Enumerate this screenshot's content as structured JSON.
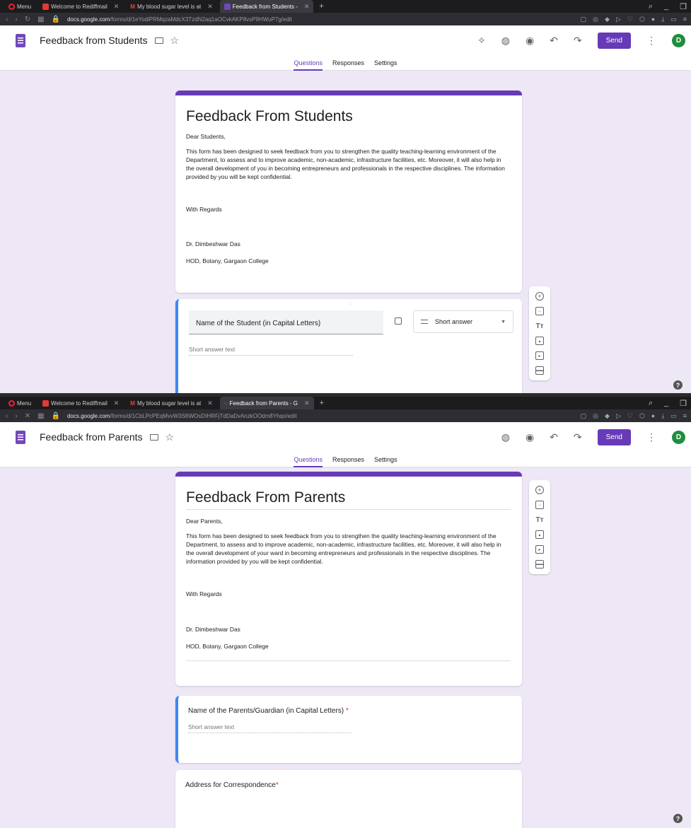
{
  "screen1": {
    "tabs": [
      {
        "label": "Menu"
      },
      {
        "label": "Welcome to Rediffmail"
      },
      {
        "label": "My blood sugar level is at"
      },
      {
        "label": "Feedback from Students - "
      }
    ],
    "url_host": "docs.google.com",
    "url_path": "/forms/d/1eYodiPRMqzaMdcX3TzdN2aq1aOCvkAKP8vsP9HWuP7g/edit",
    "doc_title": "Feedback from Students",
    "send_label": "Send",
    "avatar_letter": "D",
    "subtabs": [
      "Questions",
      "Responses",
      "Settings"
    ],
    "form_title": "Feedback From Students",
    "greeting": "Dear Students,",
    "body": "This form has been designed to seek feedback from you to strengthen the quality teaching-learning environment of the Department,  to assess and to improve academic, non-academic, infrastructure facilities, etc. Moreover, it will also help in the overall development of you in becoming entrepreneurs and professionals in the respective disciplines. The information provided by you will be kept confidential.",
    "regards": "With Regards",
    "signer": "Dr. Dimbeshwar Das",
    "designation": "HOD, Botany, Gargaon College",
    "question_title": "Name of the Student (in Capital Letters)",
    "question_type": "Short answer",
    "answer_placeholder": "Short answer text"
  },
  "screen2": {
    "tabs": [
      {
        "label": "Menu"
      },
      {
        "label": "Welcome to Rediffmail"
      },
      {
        "label": "My blood sugar level is at"
      },
      {
        "label": "Feedback from Parents - G"
      }
    ],
    "url_host": "docs.google.com",
    "url_path": "/forms/d/1CbLPcPEqMvvW3S6WOsDIHRFjTdDaDvAnzkOOdm8Yhqo/edit",
    "doc_title": "Feedback from Parents",
    "send_label": "Send",
    "avatar_letter": "D",
    "subtabs": [
      "Questions",
      "Responses",
      "Settings"
    ],
    "form_title": "Feedback From Parents",
    "greeting": "Dear Parents,",
    "body": "This form has been designed to seek feedback from you to strengthen the quality teaching-learning environment of the Department,  to assess and to improve academic, non-academic, infrastructure facilities, etc. Moreover, it will also help in the overall development of your ward in becoming entrepreneurs and professionals in the respective disciplines. The information provided by you will be kept confidential.",
    "regards": "With Regards",
    "signer": "Dr. Dimbeshwar Das",
    "designation": "HOD, Botany, Gargaon College",
    "question1_title": "Name of the Parents/Guardian (in Capital Letters)",
    "answer_placeholder": "Short answer text",
    "question2_title": "Address for Correspondence",
    "required_mark": "*"
  },
  "colors": {
    "accent": "#673ab7",
    "focus": "#4285f4",
    "background": "#eee8f6"
  }
}
